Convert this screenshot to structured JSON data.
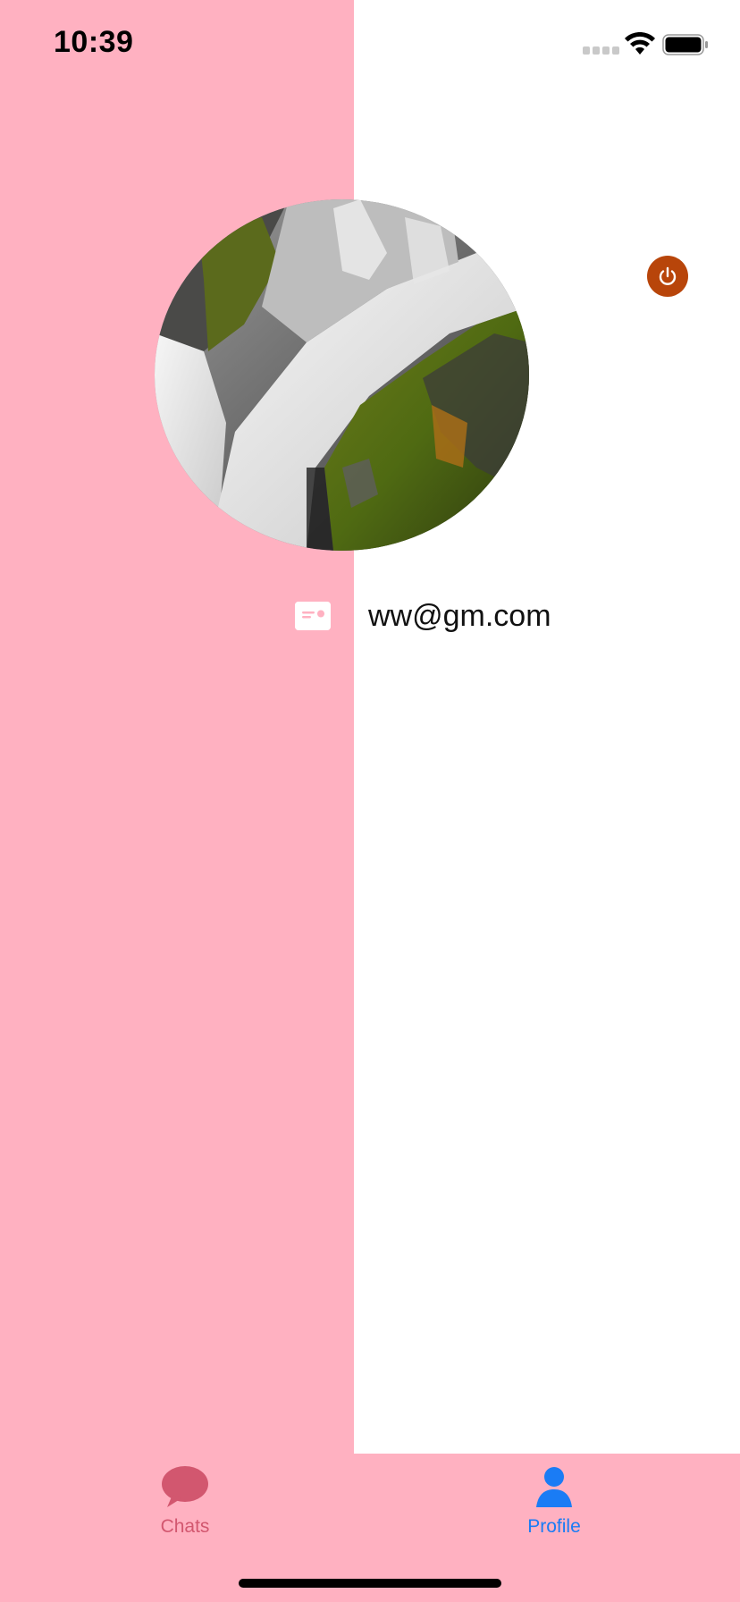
{
  "status_bar": {
    "time": "10:39"
  },
  "profile": {
    "email": "ww@gm.com",
    "avatar_desc_icon": "waterfall-photo"
  },
  "tabs": [
    {
      "label": "Chats",
      "icon": "chat-bubble-icon",
      "selected": false
    },
    {
      "label": "Profile",
      "icon": "person-icon",
      "selected": true
    }
  ],
  "colors": {
    "pink_background": "#FFB1C1",
    "power_button": "#B8450A",
    "tab_active": "#1A7CF5",
    "tab_inactive": "#D2576F"
  }
}
